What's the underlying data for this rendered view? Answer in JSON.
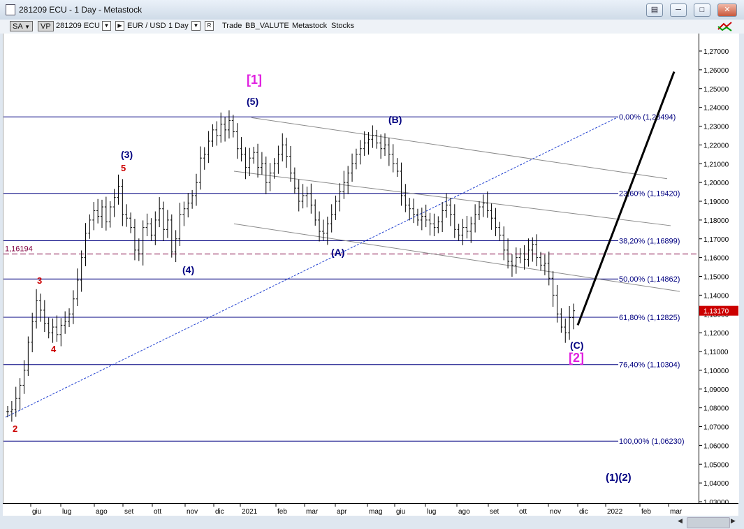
{
  "window": {
    "title": "281209 ECU - 1 Day - Metastock",
    "buttons": [
      "restore",
      "minimize",
      "maximize",
      "close"
    ]
  },
  "toolbar": {
    "sa": "SA",
    "vp": "VP",
    "symbol": "281209 ECU",
    "pair": "EUR / USD",
    "period": "1 Day",
    "r_btn": "R",
    "trade": "Trade",
    "layout": "BB_VALUTE",
    "source": "Metastock",
    "type": "Stocks"
  },
  "colors": {
    "navy": "#000080",
    "red": "#cc0000",
    "magenta": "#e020e0",
    "maroon": "#800040"
  },
  "y_labels": [
    "1,27000",
    "1,26000",
    "1,25000",
    "1,24000",
    "1,23000",
    "1,22000",
    "1,21000",
    "1,20000",
    "1,19000",
    "1,18000",
    "1,17000",
    "1,16000",
    "1,15000",
    "1,14000",
    "1,13000",
    "1,12000",
    "1,11000",
    "1,10000",
    "1,09000",
    "1,08000",
    "1,07000",
    "1,06000",
    "1,05000",
    "1,04000",
    "1,03000"
  ],
  "x_labels": [
    "giu",
    "lug",
    "ago",
    "set",
    "ott",
    "nov",
    "dic",
    "2021",
    "feb",
    "mar",
    "apr",
    "mag",
    "giu",
    "lug",
    "ago",
    "set",
    "ott",
    "nov",
    "dic",
    "2022",
    "feb",
    "mar"
  ],
  "fib_levels": [
    {
      "label": "0,00% (1,23494)"
    },
    {
      "label": "23,60% (1,19420)"
    },
    {
      "label": "38,20% (1,16899)"
    },
    {
      "label": "50,00% (1,14862)"
    },
    {
      "label": "61,80% (1,12825)"
    },
    {
      "label": "76,40% (1,10304)"
    },
    {
      "label": "100,00% (1,06230)"
    }
  ],
  "dashed_level": "1,16194",
  "last_price": "1,13170",
  "wave_labels": {
    "w1_major": "[1]",
    "w2_major": "[2]",
    "w5": "(5)",
    "w3": "(3)",
    "w4": "(4)",
    "wA": "(A)",
    "wB": "(B)",
    "wC": "(C)",
    "w1w2": "(1)(2)",
    "r2": "2",
    "r3": "3",
    "r4": "4",
    "r5": "5"
  },
  "chart_data": {
    "type": "ohlc",
    "instrument": "EUR / USD",
    "timeframe": "1 Day",
    "ylim": [
      1.03,
      1.275
    ],
    "closes": [
      1.078,
      1.079,
      1.085,
      1.092,
      1.1,
      1.115,
      1.126,
      1.137,
      1.132,
      1.125,
      1.12,
      1.123,
      1.119,
      1.124,
      1.126,
      1.13,
      1.138,
      1.148,
      1.16,
      1.173,
      1.18,
      1.185,
      1.182,
      1.187,
      1.179,
      1.187,
      1.192,
      1.198,
      1.183,
      1.181,
      1.176,
      1.164,
      1.162,
      1.176,
      1.178,
      1.172,
      1.18,
      1.186,
      1.175,
      1.18,
      1.163,
      1.17,
      1.183,
      1.186,
      1.189,
      1.193,
      1.2,
      1.213,
      1.215,
      1.222,
      1.228,
      1.225,
      1.231,
      1.228,
      1.233,
      1.227,
      1.218,
      1.215,
      1.208,
      1.213,
      1.216,
      1.208,
      1.21,
      1.2,
      1.205,
      1.21,
      1.215,
      1.22,
      1.214,
      1.205,
      1.197,
      1.19,
      1.193,
      1.194,
      1.188,
      1.18,
      1.174,
      1.173,
      1.178,
      1.183,
      1.19,
      1.195,
      1.2,
      1.205,
      1.21,
      1.215,
      1.218,
      1.221,
      1.223,
      1.225,
      1.221,
      1.218,
      1.22,
      1.215,
      1.21,
      1.206,
      1.193,
      1.188,
      1.186,
      1.183,
      1.18,
      1.182,
      1.18,
      1.178,
      1.176,
      1.179,
      1.185,
      1.188,
      1.183,
      1.175,
      1.172,
      1.176,
      1.174,
      1.178,
      1.183,
      1.187,
      1.189,
      1.185,
      1.181,
      1.176,
      1.172,
      1.164,
      1.158,
      1.156,
      1.16,
      1.162,
      1.159,
      1.164,
      1.167,
      1.16,
      1.156,
      1.157,
      1.149,
      1.14,
      1.13,
      1.123,
      1.12,
      1.128,
      1.1317
    ],
    "projection": {
      "from": 1.124,
      "to": 1.259
    },
    "channel_lines": 3,
    "trendline": "dotted, from wave 2 low to 0% fib level"
  }
}
